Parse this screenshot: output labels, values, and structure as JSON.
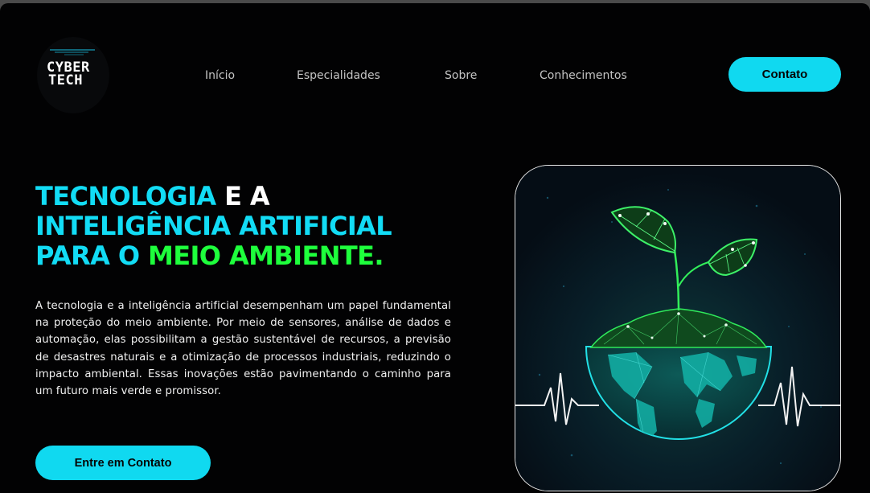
{
  "header": {
    "logo": {
      "line1": "CYBER",
      "line2": "TECH"
    },
    "nav": [
      {
        "label": "Início"
      },
      {
        "label": "Especialidades"
      },
      {
        "label": "Sobre"
      },
      {
        "label": "Conhecimentos"
      }
    ],
    "cta_label": "Contato"
  },
  "hero": {
    "headline": {
      "part1": "TECNOLOGIA",
      "part2": " E A",
      "part3": "INTELIGÊNCIA ARTIFICIAL",
      "part4": "PARA O ",
      "part5": "MEIO AMBIENTE."
    },
    "paragraph": "A tecnologia e a inteligência artificial desempenham um papel fundamental na proteção do meio ambiente. Por meio de sensores, análise de dados e automação, elas possibilitam a gestão sustentável de recursos, a previsão de desastres naturais e a otimização de processos industriais, reduzindo o impacto ambiental. Essas inovações estão pavimentando o caminho para um futuro mais verde e promissor.",
    "button_label": "Entre em Contato"
  },
  "colors": {
    "accent_cyan": "#10d9f0",
    "accent_green": "#1eff3c",
    "background": "#020203"
  },
  "icons": {
    "logo": "cyber-tech-logo",
    "hero_image": "plant-growing-on-globe-illustration"
  }
}
